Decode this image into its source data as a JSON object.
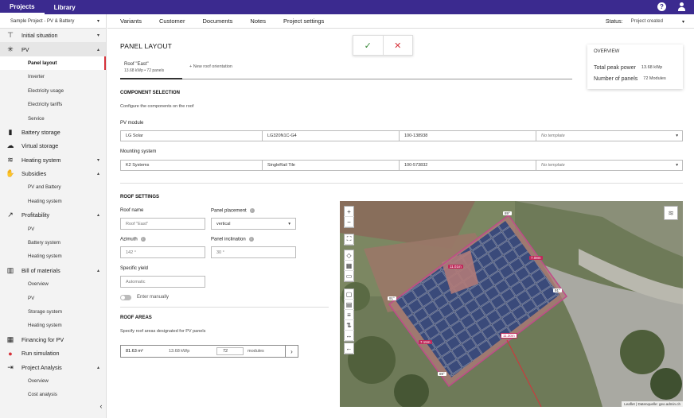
{
  "topbar": {
    "tabs": [
      "Projects",
      "Library"
    ]
  },
  "sidebar": {
    "project": "Sample Project - PV & Battery",
    "items": [
      {
        "label": "Initial situation",
        "icon": "crane-icon",
        "chev": "▾"
      },
      {
        "label": "PV",
        "icon": "sun-icon",
        "chev": "▴",
        "subs": [
          "Panel layout",
          "Inverter",
          "Electricity usage",
          "Electricity tariffs",
          "Service"
        ]
      },
      {
        "label": "Battery storage",
        "icon": "battery-icon"
      },
      {
        "label": "Virtual storage",
        "icon": "cloud-icon"
      },
      {
        "label": "Heating system",
        "icon": "waves-icon",
        "chev": "▾"
      },
      {
        "label": "Subsidies",
        "icon": "handshake-icon",
        "chev": "▴",
        "subs": [
          "PV and Battery",
          "Heating system"
        ]
      },
      {
        "label": "Profitability",
        "icon": "trend-icon",
        "chev": "▴",
        "subs": [
          "PV",
          "Battery system",
          "Heating system"
        ]
      },
      {
        "label": "Bill of materials",
        "icon": "barcode-icon",
        "chev": "▴",
        "subs": [
          "Overview",
          "PV",
          "Storage system",
          "Heating system"
        ]
      },
      {
        "label": "Financing for PV",
        "icon": "building-icon"
      },
      {
        "label": "Run simulation",
        "icon": "record-icon"
      },
      {
        "label": "Project Analysis",
        "icon": "export-icon",
        "chev": "▴",
        "subs": [
          "Overview",
          "Cost analysis"
        ]
      }
    ]
  },
  "nav": {
    "tabs": [
      "Variants",
      "Customer",
      "Documents",
      "Notes",
      "Project settings"
    ],
    "status_label": "Status:",
    "status_value": "Project created"
  },
  "page": {
    "title": "PANEL LAYOUT"
  },
  "overview": {
    "title": "OVERVIEW",
    "power_label": "Total peak power",
    "power_value": "13.68 kWp",
    "panels_label": "Number of panels",
    "panels_value": "72 Modules"
  },
  "roof_tab": {
    "name": "Roof \"East\"",
    "sub": "13.68 kWp • 72 panels",
    "new": "+ New roof orientation"
  },
  "component": {
    "title": "COMPONENT SELECTION",
    "desc": "Configure the components on the roof",
    "pv_label": "PV module",
    "pv": [
      "LG Solar",
      "LG320N1C-G4",
      "100-138938",
      "No template"
    ],
    "mount_label": "Mounting system",
    "mount": [
      "K2 Systems",
      "SingleRail Tile",
      "100-573832",
      "No template"
    ]
  },
  "roof_settings": {
    "title": "ROOF SETTINGS",
    "name_label": "Roof name",
    "name_ph": "Roof \"East\"",
    "placement_label": "Panel placement",
    "placement": "vertical",
    "azimuth_label": "Azimuth",
    "azimuth": "142 °",
    "incl_label": "Panel inclination",
    "incl": "30 °",
    "yield_label": "Specific yield",
    "yield_ph": "Automatic",
    "toggle_label": "Enter manually"
  },
  "roof_areas": {
    "title": "ROOF AREAS",
    "desc": "Specify roof areas designated for PV panels",
    "area": "81.63 m²",
    "kwp": "13.68 kWp",
    "count": "72",
    "unit": "modules"
  },
  "map": {
    "labels": [
      "89°",
      "7.08m",
      "11.01m",
      "91°",
      "91°",
      "7.15m",
      "11.30m",
      "89°"
    ],
    "attribution": "Leaflet | Datenquelle: geo.admin.ch"
  }
}
